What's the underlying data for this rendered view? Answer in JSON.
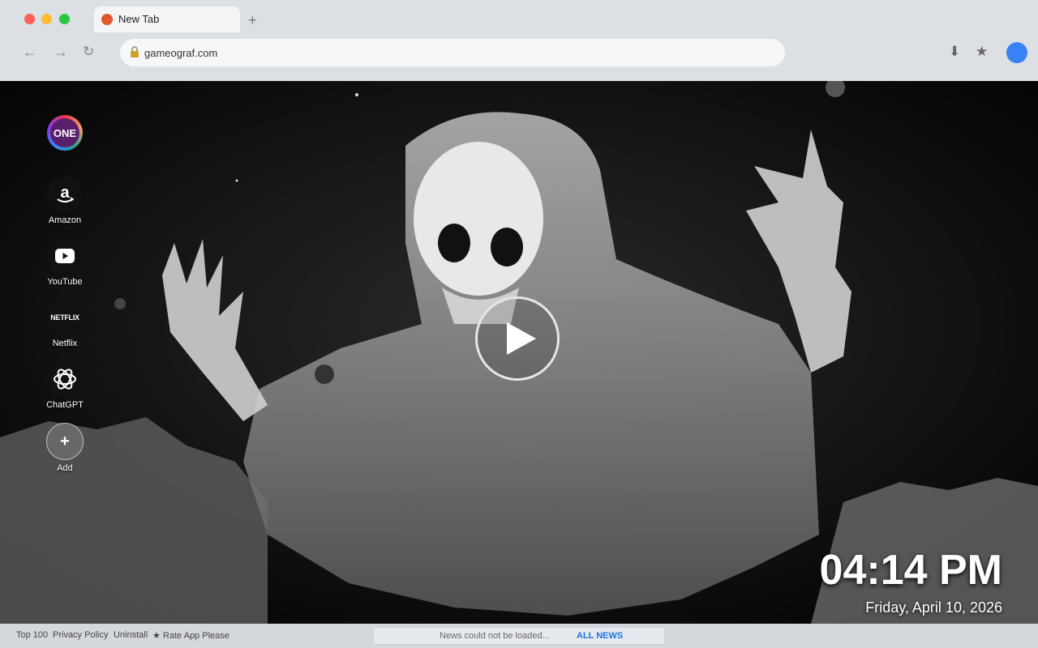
{
  "browser": {
    "tab_title": "New Tab",
    "new_tab_symbol": "+",
    "nav_back": "←",
    "nav_forward": "→",
    "nav_reload": "↻",
    "url": "gameograf.com",
    "download_symbol": "⬇",
    "bookmark_symbol": "★"
  },
  "shortcuts": [
    {
      "label": "",
      "icon": "gameograf-one-icon",
      "badge": "ONE"
    },
    {
      "label": "Amazon",
      "icon": "amazon-icon"
    },
    {
      "label": "YouTube",
      "icon": "youtube-icon"
    },
    {
      "label": "Netflix",
      "icon": "netflix-icon",
      "badge": "NETFLIX"
    },
    {
      "label": "ChatGPT",
      "icon": "chatgpt-icon"
    },
    {
      "label": "Add",
      "icon": "plus-icon",
      "badge": "+"
    }
  ],
  "clock": {
    "time": "04:14 PM",
    "date": "Friday, April 10, 2026"
  },
  "footer": {
    "links": [
      "Top 100",
      "Privacy Policy",
      "Uninstall",
      "★ Rate App Please"
    ],
    "news_status": "News could not be loaded...",
    "news_button": "ALL NEWS"
  },
  "colors": {
    "tab_favicon": "#e0592a",
    "profile": "#3b82f6",
    "news_button": "#1a73e8"
  }
}
